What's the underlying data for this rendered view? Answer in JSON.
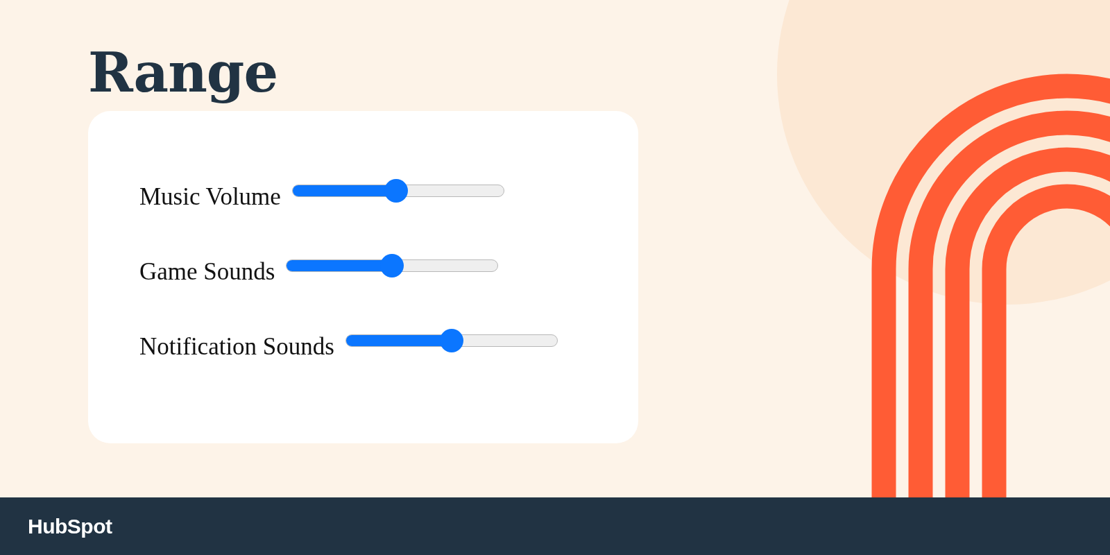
{
  "title": "Range",
  "sliders": [
    {
      "label": "Music Volume",
      "level": 0.49
    },
    {
      "label": "Game Sounds",
      "level": 0.5
    },
    {
      "label": "Notification Sounds",
      "level": 0.5
    }
  ],
  "footer": {
    "brand": "HubSpot"
  }
}
